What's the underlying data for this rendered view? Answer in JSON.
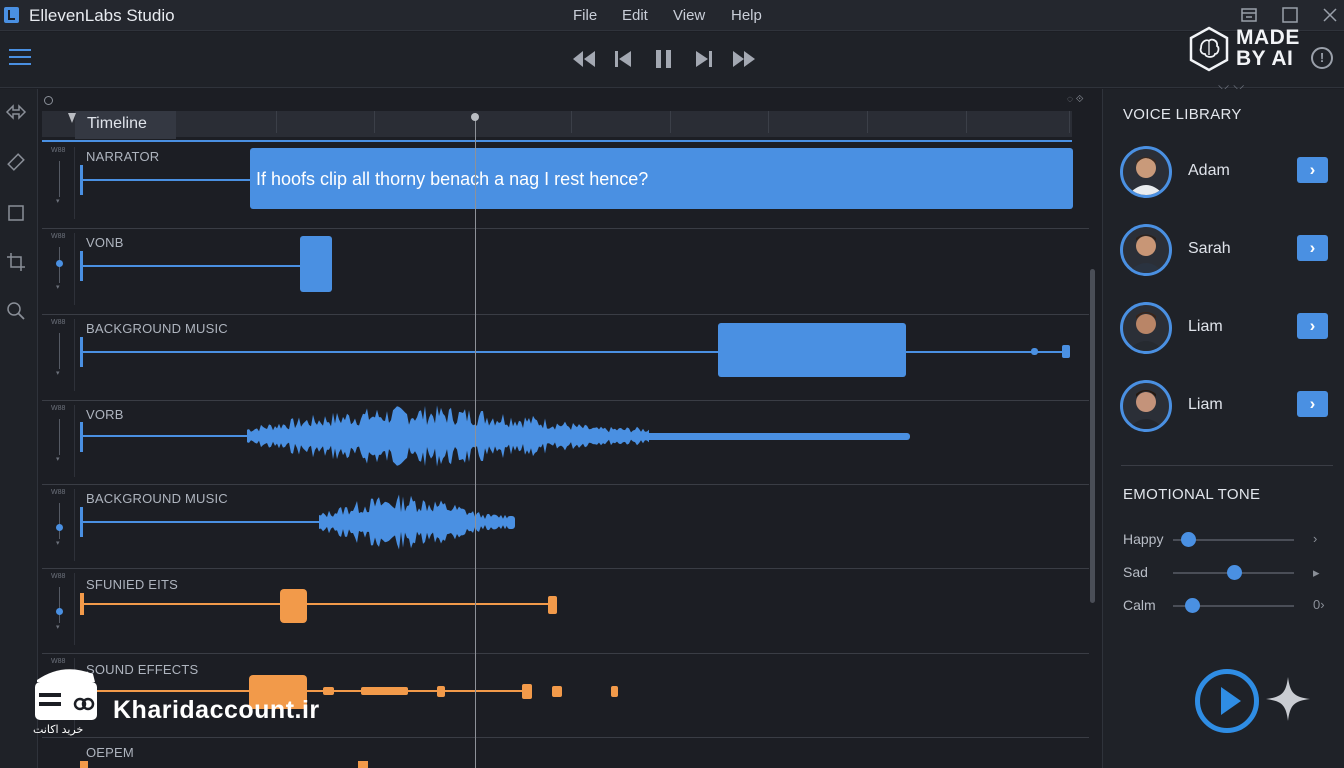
{
  "app": {
    "title": "EllevenLabs Studio",
    "menu": [
      "File",
      "Edit",
      "View",
      "Help"
    ]
  },
  "toolbar": {
    "transport": [
      "rewind-icon",
      "skip-back-icon",
      "pause-icon",
      "skip-forward-icon",
      "fast-forward-icon"
    ],
    "badge_line1": "MADE",
    "badge_line2": "BY AI"
  },
  "timeline": {
    "label": "Timeline",
    "tracks": [
      {
        "label": "NARRATOR",
        "color": "#4a90e2"
      },
      {
        "label": "VONB",
        "color": "#4a90e2"
      },
      {
        "label": "BACKGROUND MUSIC",
        "color": "#4a90e2"
      },
      {
        "label": "VORB",
        "color": "#4a90e2"
      },
      {
        "label": "BACKGROUND MUSIC",
        "color": "#4a90e2"
      },
      {
        "label": "SFUNIED EITS",
        "color": "#f29a4a"
      },
      {
        "label": "SOUND EFFECTS",
        "color": "#f29a4a"
      },
      {
        "label": "OEPEM",
        "color": "#f29a4a"
      }
    ],
    "narrator_clip_text": "If hoofs clip all thorny benach a nag I rest hence?",
    "track_mini_label": "W88"
  },
  "voice_library": {
    "heading": "VOICE LIBRARY",
    "voices": [
      {
        "name": "Adam"
      },
      {
        "name": "Sarah"
      },
      {
        "name": "Liam"
      },
      {
        "name": "Liam"
      }
    ]
  },
  "emotional_tone": {
    "heading": "EMOTIONAL TONE",
    "sliders": [
      {
        "label": "Happy",
        "value": 0.12,
        "end": "›"
      },
      {
        "label": "Sad",
        "value": 0.5,
        "end": "▸"
      },
      {
        "label": "Calm",
        "value": 0.16,
        "end": "0›"
      }
    ]
  },
  "watermark": {
    "text": "Kharidaccount.ir",
    "sub": "خرید اکانت"
  },
  "colors": {
    "accent": "#4a90e2",
    "sfx": "#f29a4a",
    "background": "#1c1e24"
  }
}
